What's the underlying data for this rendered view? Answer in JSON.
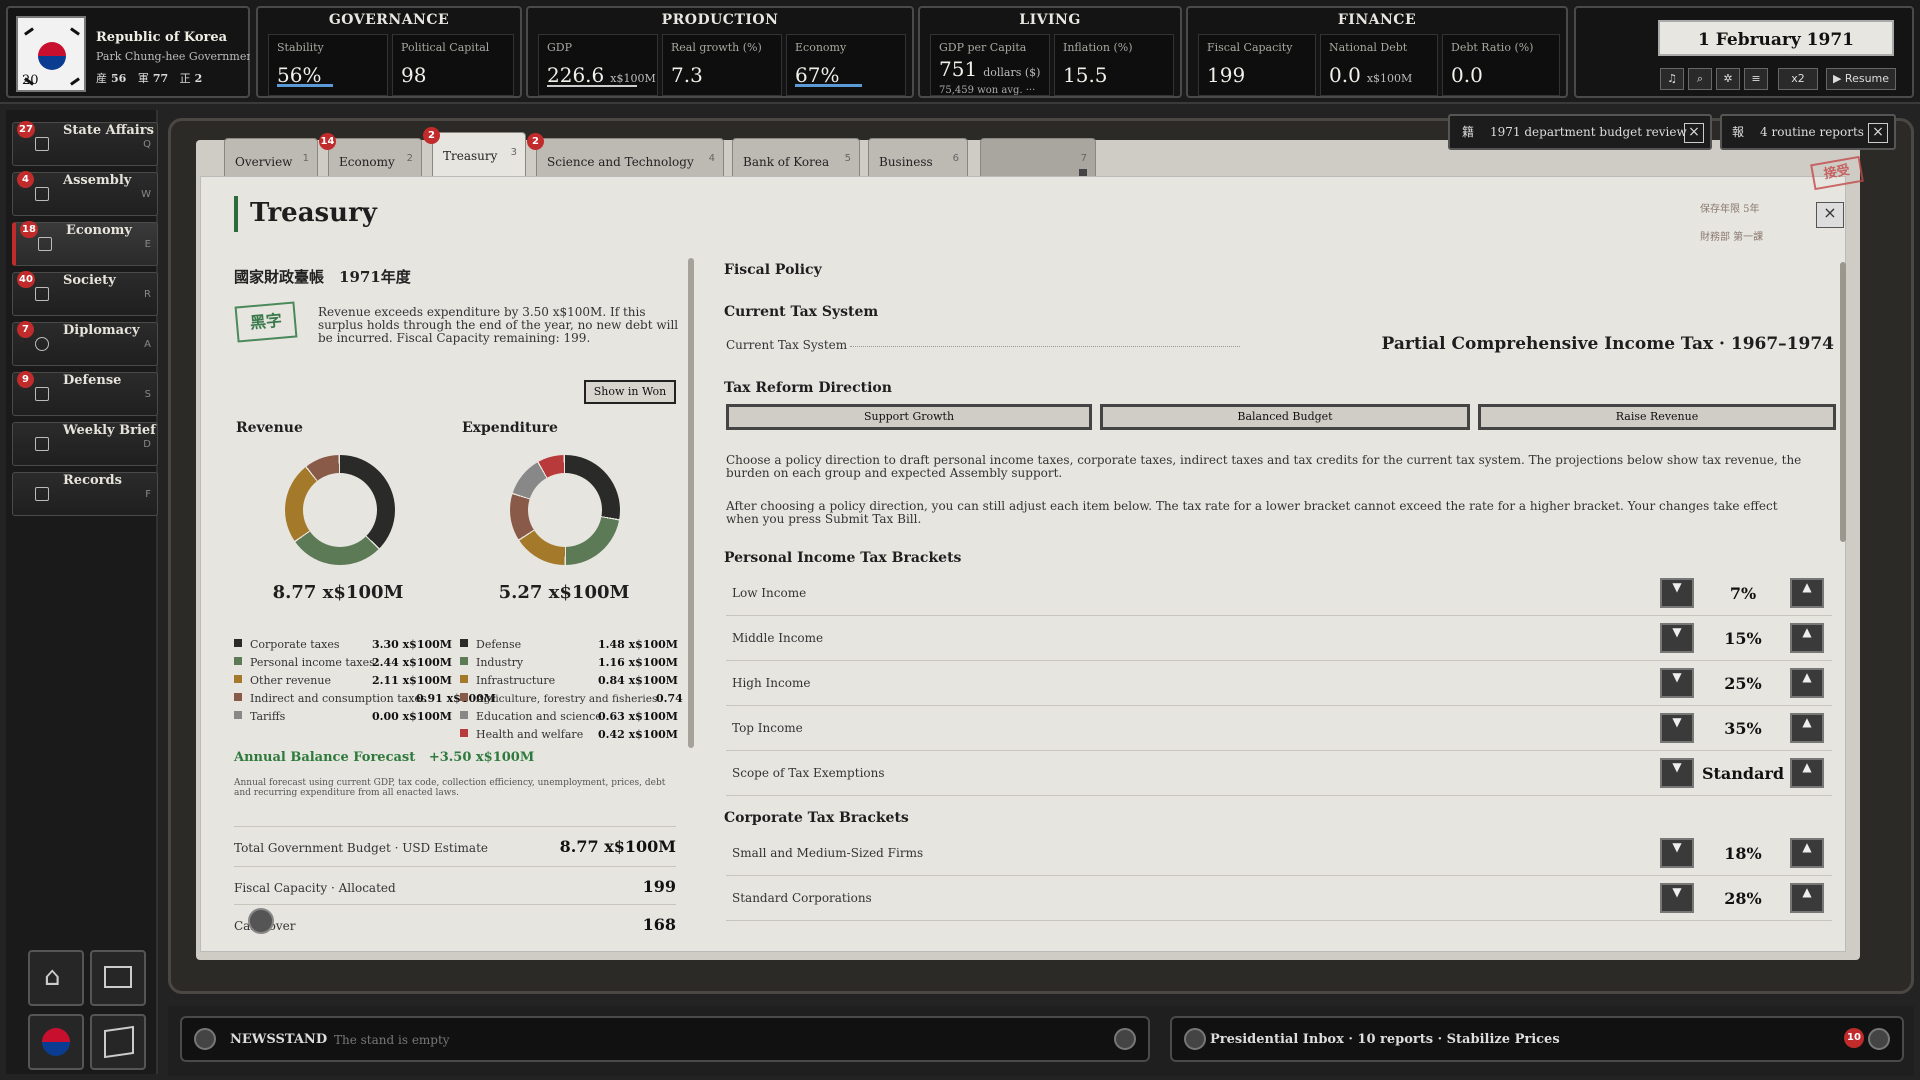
{
  "country": {
    "name": "Republic of Korea",
    "government": "Park Chung-hee Government",
    "flag_number": "20",
    "stat1_label": "産",
    "stat1_value": "56",
    "stat2_label": "軍",
    "stat2_value": "77",
    "stat3_label": "正",
    "stat3_value": "2"
  },
  "governance": {
    "title": "GOVERNANCE",
    "stability_label": "Stability",
    "stability_value": "56%",
    "stability_level": 0.56,
    "capital_label": "Political Capital",
    "capital_value": "98"
  },
  "production": {
    "title": "PRODUCTION",
    "gdp_label": "GDP",
    "gdp_value": "226.6",
    "gdp_unit": "x$100M",
    "growth_label": "Real growth (%)",
    "growth_value": "7.3",
    "economy_label": "Economy",
    "economy_value": "67%",
    "economy_level": 0.67
  },
  "living": {
    "title": "LIVING",
    "gdppc_label": "GDP per Capita",
    "gdppc_value": "751",
    "gdppc_unit": "dollars ($)",
    "gdppc_sub": "75,459 won avg. ···",
    "inflation_label": "Inflation (%)",
    "inflation_value": "15.5"
  },
  "finance": {
    "title": "FINANCE",
    "capacity_label": "Fiscal Capacity",
    "capacity_value": "199",
    "debt_label": "National Debt",
    "debt_value": "0.0",
    "debt_unit": "x$100M",
    "ratio_label": "Debt Ratio (%)",
    "ratio_value": "0.0"
  },
  "date": {
    "current": "1 February 1971",
    "speed": "x2",
    "resume": "▶ Resume"
  },
  "sidebar": {
    "items": [
      {
        "label": "State Affairs",
        "key": "Q",
        "badge": "27"
      },
      {
        "label": "Assembly",
        "key": "W",
        "badge": "4"
      },
      {
        "label": "Economy",
        "key": "E",
        "badge": "18"
      },
      {
        "label": "Society",
        "key": "R",
        "badge": "40"
      },
      {
        "label": "Diplomacy",
        "key": "A",
        "badge": "7"
      },
      {
        "label": "Defense",
        "key": "S",
        "badge": "9"
      },
      {
        "label": "Weekly Brief",
        "key": "D",
        "badge": ""
      },
      {
        "label": "Records",
        "key": "F",
        "badge": ""
      }
    ]
  },
  "tabs": [
    {
      "label": "Overview",
      "num": "1",
      "badge": ""
    },
    {
      "label": "Economy",
      "num": "2",
      "badge": "14"
    },
    {
      "label": "Treasury",
      "num": "3",
      "badge": "2"
    },
    {
      "label": "Science and Technology",
      "num": "4",
      "badge": "2"
    },
    {
      "label": "Bank of Korea",
      "num": "5",
      "badge": ""
    },
    {
      "label": "Business",
      "num": "6",
      "badge": ""
    },
    {
      "label": "",
      "num": "7",
      "badge": ""
    }
  ],
  "reports": {
    "budget_review": "1971 department budget review",
    "routine": "4 routine reports",
    "budget_icon": "籍",
    "routine_icon": "報"
  },
  "treasury": {
    "title": "Treasury",
    "stamp": "接受",
    "meta1": "保存年限 5年",
    "meta2": "財務部 第一課",
    "ledger_title": "國家財政臺帳　1971年度",
    "surplus_stamp": "黑字",
    "surplus_text": "Revenue exceeds expenditure by 3.50 x$100M. If this surplus holds through the end of the year, no new debt will be incurred. Fiscal Capacity remaining: 199.",
    "show_in_won": "Show in Won",
    "revenue_label": "Revenue",
    "expenditure_label": "Expenditure",
    "revenue_total": "8.77 x$100M",
    "expenditure_total": "5.27 x$100M",
    "revenue_items": [
      {
        "label": "Corporate taxes",
        "value": "3.30 x$100M",
        "color": "#2a2a28"
      },
      {
        "label": "Personal income taxes",
        "value": "2.44 x$100M",
        "color": "#5b7a55"
      },
      {
        "label": "Other revenue",
        "value": "2.11 x$100M",
        "color": "#a47a2a"
      },
      {
        "label": "Indirect and consumption taxes",
        "value": "0.91 x$100M",
        "color": "#8a5a48"
      },
      {
        "label": "Tariffs",
        "value": "0.00 x$100M",
        "color": "#888"
      }
    ],
    "expenditure_items": [
      {
        "label": "Defense",
        "value": "1.48 x$100M",
        "color": "#2a2a28"
      },
      {
        "label": "Industry",
        "value": "1.16 x$100M",
        "color": "#5b7a55"
      },
      {
        "label": "Infrastructure",
        "value": "0.84 x$100M",
        "color": "#a47a2a"
      },
      {
        "label": "Agriculture, forestry and fisheries",
        "value": "0.74",
        "color": "#8a5a48"
      },
      {
        "label": "Education and science",
        "value": "0.63 x$100M",
        "color": "#888"
      },
      {
        "label": "Health and welfare",
        "value": "0.42 x$100M",
        "color": "#b83a3a"
      }
    ],
    "annual_label": "Annual Balance Forecast",
    "annual_value": "+3.50 x$100M",
    "annual_note": "Annual forecast using current GDP, tax code, collection efficiency, unemployment, prices, debt and recurring expenditure from all enacted laws.",
    "budget_rows": [
      {
        "label": "Total Government Budget · USD Estimate",
        "value": "8.77 x$100M"
      },
      {
        "label": "Fiscal Capacity · Allocated",
        "value": "199"
      },
      {
        "label": "Carryover",
        "value": "168"
      }
    ]
  },
  "fiscal": {
    "heading": "Fiscal Policy",
    "current_heading": "Current Tax System",
    "current_label": "Current Tax System",
    "current_value": "Partial Comprehensive Income Tax · 1967–1974",
    "reform_heading": "Tax Reform Direction",
    "directions": [
      "Support Growth",
      "Balanced Budget",
      "Raise Revenue"
    ],
    "para1": "Choose a policy direction to draft personal income taxes, corporate taxes, indirect taxes and tax credits for the current tax system. The projections below show tax revenue, the burden on each group and expected Assembly support.",
    "para2": "After choosing a policy direction, you can still adjust each item below. The tax rate for a lower bracket cannot exceed the rate for a higher bracket. Your changes take effect when you press Submit Tax Bill.",
    "personal_heading": "Personal Income Tax Brackets",
    "personal": [
      {
        "label": "Low Income",
        "value": "7%"
      },
      {
        "label": "Middle Income",
        "value": "15%"
      },
      {
        "label": "High Income",
        "value": "25%"
      },
      {
        "label": "Top Income",
        "value": "35%"
      },
      {
        "label": "Scope of Tax Exemptions",
        "value": "Standard"
      }
    ],
    "corporate_heading": "Corporate Tax Brackets",
    "corporate": [
      {
        "label": "Small and Medium-Sized Firms",
        "value": "18%"
      },
      {
        "label": "Standard Corporations",
        "value": "28%"
      }
    ]
  },
  "bottom": {
    "newsstand": "NEWSSTAND",
    "newsstand_text": "The stand is empty",
    "inbox": "Presidential Inbox · 10 reports · Stabilize Prices",
    "inbox_badge": "10"
  }
}
